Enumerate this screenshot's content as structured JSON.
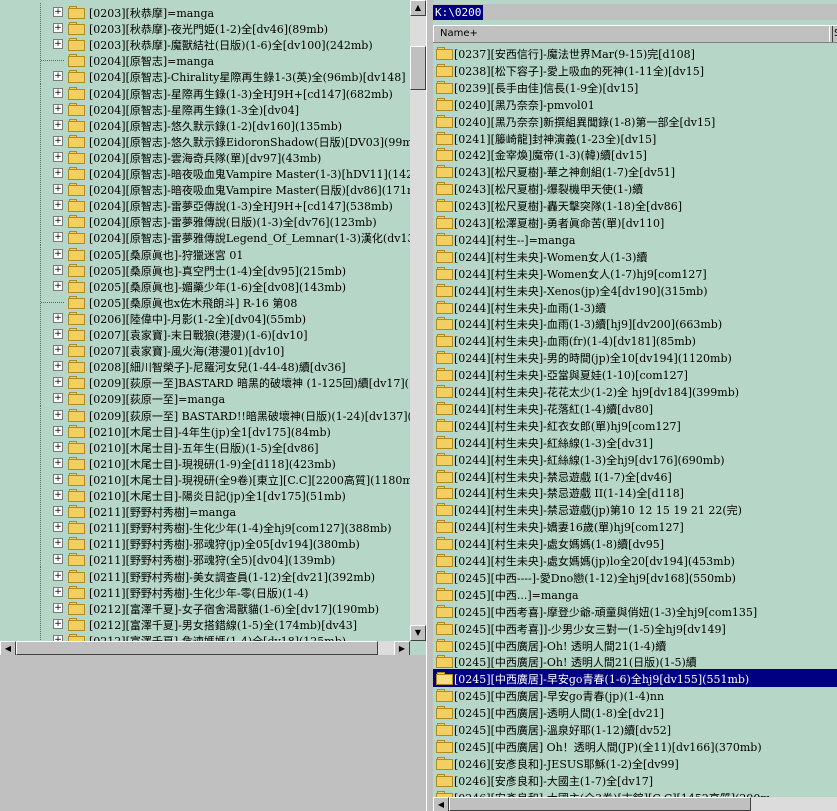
{
  "left_tree": {
    "items": [
      "[0203][秋恭摩]=manga",
      "[0203][秋恭摩]-夜光門姫(1-2)全[dv46](89mb)",
      "[0203][秋恭摩]-魔獸結社(日版)(1-6)全[dv100](242mb)",
      "[0204][原智志]=manga",
      "[0204][原智志]-Chirality星際再生錄1-3(英)全(96mb)[dv148]",
      "[0204][原智志]-星際再生錄(1-3)全HJ9H+[cd147](682mb)",
      "[0204][原智志]-星際再生錄(1-3全)[dv04]",
      "[0204][原智志]-悠久默示錄(1-2)[dv160](135mb)",
      "[0204][原智志]-悠久默示錄EidoronShadow(日版)[DV03](99mb)",
      "[0204][原智志]-雲海奇兵隊(單)[dv97](43mb)",
      "[0204][原智志]-暗夜吸血鬼Vampire Master(1-3)[hDV11](142m",
      "[0204][原智志]-暗夜吸血鬼Vampire Master(日版)[dv86](171mb",
      "[0204][原智志]-雷夢亞傳說(1-3)全HJ9H+[cd147](538mb)",
      "[0204][原智志]-雷夢雅傳說(日版)(1-3)全[dv76](123mb)",
      "[0204][原智志]-雷夢雅傳說Legend_Of_Lemnar(1-3)漢化(dv130",
      "[0205][桑原眞也]-狩獵迷宮 01",
      "[0205][桑原眞也]-真空門士(1-4)全[dv95](215mb)",
      "[0205][桑原眞也]-媚藥少年(1-6)全[dv08](143mb)",
      "[0205][桑原眞也x佐木飛朗斗] R-16 第08",
      "[0206][陸偉中]-月影(1-2全)[dv04](55mb)",
      "[0207][袁家寶]-末日戰狼(港漫)(1-6)[dv10]",
      "[0207][袁家寶]-風火海(港漫01)[dv10]",
      "[0208][細川智榮子]-尼羅河女兒(1-44-48)續[dv36]",
      "[0209][荻原一至]BASTARD 暗黑的破壞神 (1-125回)續[dv17](",
      "[0209][荻原一至]=manga",
      "[0209][荻原一至] BASTARD!!暗黑破壞神(日版)(1-24)[dv137](",
      "[0210][木尾士目]-4年生(jp)全1[dv175](84mb)",
      "[0210][木尾士目]-五年生(日版)(1-5)全[dv86]",
      "[0210][木尾士目]-現視研(1-9)全[d118](423mb)",
      "[0210][木尾士目]-現視研(全9卷)[東立][C.C][2200高質](1180m",
      "[0210][木尾士目]-陽炎日記(jp)全1[dv175](51mb)",
      "[0211][野野村秀樹]=manga",
      "[0211][野野村秀樹]-生化少年(1-4)全hj9[com127](388mb)",
      "[0211][野野村秀樹]-邪魂狩(jp)全05[dv194](380mb)",
      "[0211][野野村秀樹]-邪魂狩(全5)[dv04](139mb)",
      "[0211][野野村秀樹]-美女調查員(1-12)全[dv21](392mb)",
      "[0211][野野村秀樹]-生化少年-零(日版)(1-4)",
      "[0212][富澤千夏]-女子宿舍渴獸貓(1-6)全[dv17](190mb)",
      "[0212][富澤千夏]-男女搭錯線(1-5)全(174mb)[dv43]",
      "[0212][富澤千夏]-危速媽媽(1-4)全[dv18](125mb)"
    ],
    "no_expander": [
      3,
      18
    ]
  },
  "address": {
    "value": "K:\\0200"
  },
  "columns": {
    "name": "Name+",
    "second": "S"
  },
  "files": [
    "[0237][安西信行]-魔法世界Mar(9-15)完[d108]",
    "[0238][松下容子]-愛上吸血的死神(1-11全)[dv15]",
    "[0239][長手由佳]信長(1-9全)[dv15]",
    "[0240][黑乃奈奈]-pmvol01",
    "[0240][黑乃奈奈]新撰組異聞錄(1-8)第一部全[dv15]",
    "[0241][籐崎龍]封神演義(1-23全)[dv15]",
    "[0242][金宰煥]魔帝(1-3)(韓)續[dv15]",
    "[0243][松尺夏樹]-華之神劍組(1-7)全[dv51]",
    "[0243][松尺夏樹]-爆裂機甲天使(1-)續",
    "[0243][松尺夏樹]-轟天擊突隊(1-18)全[dv86]",
    "[0243][松澤夏樹]-勇者眞命苦(單)[dv110]",
    "[0244][村生--]=manga",
    "[0244][村生未央]-Women女人(1-3)續",
    "[0244][村生未央]-Women女人(1-7)hj9[com127]",
    "[0244][村生未央]-Xenos(jp)全4[dv190](315mb)",
    "[0244][村生未央]-血雨(1-3)續",
    "[0244][村生未央]-血雨(1-3)續[hj9][dv200](663mb)",
    "[0244][村生未央]-血雨(fr)(1-4)[dv181](85mb)",
    "[0244][村生未央]-男的時間(jp)全10[dv194](1120mb)",
    "[0244][村生未央]-亞當與夏娃(1-10)[com127]",
    "[0244][村生未央]-花花太少(1-2)全 hj9[dv184](399mb)",
    "[0244][村生未央]-花落紅(1-4)續[dv80]",
    "[0244][村生未央]-紅衣女郎(單)hj9[com127]",
    "[0244][村生未央]-紅絲線(1-3)全[dv31]",
    "[0244][村生未央]-紅絲線(1-3)全hj9[dv176](690mb)",
    "[0244][村生未央]-禁忌遊戲 I(1-7)全[dv46]",
    "[0244][村生未央]-禁忌遊戲 II(1-14)全[d118]",
    "[0244][村生未央]-禁忌遊戲(jp)第10 12 15 19 21 22(完)",
    "[0244][村生未央]-嬌妻16歲(單)hj9[com127]",
    "[0244][村生未央]-處女媽媽(1-8)續[dv95]",
    "[0244][村生未央]-處女媽媽(jp)lo全20[dv194](453mb)",
    "[0245][中西----]-愛Dno戀(1-12)全hj9[dv168](550mb)",
    "[0245][中西...]=manga",
    "[0245][中西考喜]-摩登少爺-頑童與俏妞(1-3)全hj9[com135]",
    "[0245][中西考喜]]-少男少女三對一(1-5)全hj9[dv149]",
    "[0245][中西廣居]-Oh! 透明人間21(1-4)續",
    "[0245][中西廣居]-Oh! 透明人間21(日版)(1-5)續",
    "[0245][中西廣居]-早安go青春(1-6)全hj9[dv155](551mb)",
    "[0245][中西廣居]-早安go青春(jp)(1-4)nn",
    "[0245][中西廣居]-透明人間(1-8)全[dv21]",
    "[0245][中西廣居]-溫泉好耶(1-12)續[dv52]",
    "[0245][中西廣居] Oh！透明人間(JP)(全11)[dv166](370mb)",
    "[0246][安彥良和]-JESUS耶穌(1-2)全[dv99]",
    "[0246][安彥良和]-大國主(1-7)全[dv17]",
    "[0246][安彥良和]-大國主(全3卷)[古館][C.C][1452高質](290m"
  ],
  "selected_index": 37
}
